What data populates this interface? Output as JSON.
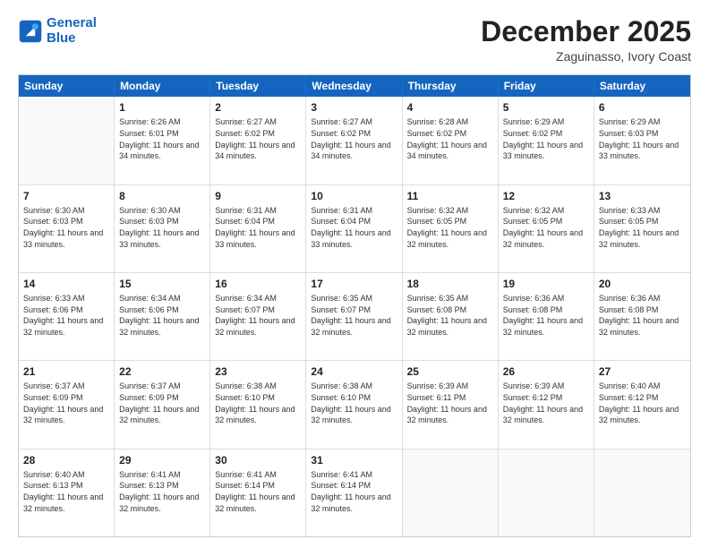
{
  "logo": {
    "line1": "General",
    "line2": "Blue"
  },
  "title": "December 2025",
  "subtitle": "Zaguinasso, Ivory Coast",
  "header": {
    "days": [
      "Sunday",
      "Monday",
      "Tuesday",
      "Wednesday",
      "Thursday",
      "Friday",
      "Saturday"
    ]
  },
  "weeks": [
    [
      {
        "day": "",
        "info": ""
      },
      {
        "day": "1",
        "info": "Sunrise: 6:26 AM\nSunset: 6:01 PM\nDaylight: 11 hours and 34 minutes."
      },
      {
        "day": "2",
        "info": "Sunrise: 6:27 AM\nSunset: 6:02 PM\nDaylight: 11 hours and 34 minutes."
      },
      {
        "day": "3",
        "info": "Sunrise: 6:27 AM\nSunset: 6:02 PM\nDaylight: 11 hours and 34 minutes."
      },
      {
        "day": "4",
        "info": "Sunrise: 6:28 AM\nSunset: 6:02 PM\nDaylight: 11 hours and 34 minutes."
      },
      {
        "day": "5",
        "info": "Sunrise: 6:29 AM\nSunset: 6:02 PM\nDaylight: 11 hours and 33 minutes."
      },
      {
        "day": "6",
        "info": "Sunrise: 6:29 AM\nSunset: 6:03 PM\nDaylight: 11 hours and 33 minutes."
      }
    ],
    [
      {
        "day": "7",
        "info": "Sunrise: 6:30 AM\nSunset: 6:03 PM\nDaylight: 11 hours and 33 minutes."
      },
      {
        "day": "8",
        "info": "Sunrise: 6:30 AM\nSunset: 6:03 PM\nDaylight: 11 hours and 33 minutes."
      },
      {
        "day": "9",
        "info": "Sunrise: 6:31 AM\nSunset: 6:04 PM\nDaylight: 11 hours and 33 minutes."
      },
      {
        "day": "10",
        "info": "Sunrise: 6:31 AM\nSunset: 6:04 PM\nDaylight: 11 hours and 33 minutes."
      },
      {
        "day": "11",
        "info": "Sunrise: 6:32 AM\nSunset: 6:05 PM\nDaylight: 11 hours and 32 minutes."
      },
      {
        "day": "12",
        "info": "Sunrise: 6:32 AM\nSunset: 6:05 PM\nDaylight: 11 hours and 32 minutes."
      },
      {
        "day": "13",
        "info": "Sunrise: 6:33 AM\nSunset: 6:05 PM\nDaylight: 11 hours and 32 minutes."
      }
    ],
    [
      {
        "day": "14",
        "info": "Sunrise: 6:33 AM\nSunset: 6:06 PM\nDaylight: 11 hours and 32 minutes."
      },
      {
        "day": "15",
        "info": "Sunrise: 6:34 AM\nSunset: 6:06 PM\nDaylight: 11 hours and 32 minutes."
      },
      {
        "day": "16",
        "info": "Sunrise: 6:34 AM\nSunset: 6:07 PM\nDaylight: 11 hours and 32 minutes."
      },
      {
        "day": "17",
        "info": "Sunrise: 6:35 AM\nSunset: 6:07 PM\nDaylight: 11 hours and 32 minutes."
      },
      {
        "day": "18",
        "info": "Sunrise: 6:35 AM\nSunset: 6:08 PM\nDaylight: 11 hours and 32 minutes."
      },
      {
        "day": "19",
        "info": "Sunrise: 6:36 AM\nSunset: 6:08 PM\nDaylight: 11 hours and 32 minutes."
      },
      {
        "day": "20",
        "info": "Sunrise: 6:36 AM\nSunset: 6:08 PM\nDaylight: 11 hours and 32 minutes."
      }
    ],
    [
      {
        "day": "21",
        "info": "Sunrise: 6:37 AM\nSunset: 6:09 PM\nDaylight: 11 hours and 32 minutes."
      },
      {
        "day": "22",
        "info": "Sunrise: 6:37 AM\nSunset: 6:09 PM\nDaylight: 11 hours and 32 minutes."
      },
      {
        "day": "23",
        "info": "Sunrise: 6:38 AM\nSunset: 6:10 PM\nDaylight: 11 hours and 32 minutes."
      },
      {
        "day": "24",
        "info": "Sunrise: 6:38 AM\nSunset: 6:10 PM\nDaylight: 11 hours and 32 minutes."
      },
      {
        "day": "25",
        "info": "Sunrise: 6:39 AM\nSunset: 6:11 PM\nDaylight: 11 hours and 32 minutes."
      },
      {
        "day": "26",
        "info": "Sunrise: 6:39 AM\nSunset: 6:12 PM\nDaylight: 11 hours and 32 minutes."
      },
      {
        "day": "27",
        "info": "Sunrise: 6:40 AM\nSunset: 6:12 PM\nDaylight: 11 hours and 32 minutes."
      }
    ],
    [
      {
        "day": "28",
        "info": "Sunrise: 6:40 AM\nSunset: 6:13 PM\nDaylight: 11 hours and 32 minutes."
      },
      {
        "day": "29",
        "info": "Sunrise: 6:41 AM\nSunset: 6:13 PM\nDaylight: 11 hours and 32 minutes."
      },
      {
        "day": "30",
        "info": "Sunrise: 6:41 AM\nSunset: 6:14 PM\nDaylight: 11 hours and 32 minutes."
      },
      {
        "day": "31",
        "info": "Sunrise: 6:41 AM\nSunset: 6:14 PM\nDaylight: 11 hours and 32 minutes."
      },
      {
        "day": "",
        "info": ""
      },
      {
        "day": "",
        "info": ""
      },
      {
        "day": "",
        "info": ""
      }
    ]
  ]
}
